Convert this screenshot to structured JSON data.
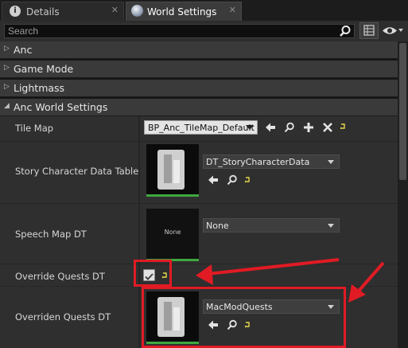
{
  "tabs": [
    {
      "label": "Details",
      "icon": "details-icon",
      "active": false
    },
    {
      "label": "World Settings",
      "icon": "world-globe-icon",
      "active": true
    }
  ],
  "search": {
    "placeholder": "Search",
    "value": ""
  },
  "categories": [
    {
      "label": "Anc",
      "expanded": false
    },
    {
      "label": "Game Mode",
      "expanded": false
    },
    {
      "label": "Lightmass",
      "expanded": false
    },
    {
      "label": "Anc World Settings",
      "expanded": true
    }
  ],
  "properties": {
    "tile_map": {
      "label": "Tile Map",
      "value": "BP_Anc_TileMap_Default"
    },
    "story_character_data_table": {
      "label": "Story Character Data Table",
      "value": "DT_StoryCharacterData"
    },
    "speech_map_dt": {
      "label": "Speech Map DT",
      "value": "None",
      "thumb_text": "None"
    },
    "override_quests_dt": {
      "label": "Override Quests DT",
      "checked": true
    },
    "overriden_quests_dt": {
      "label": "Overriden Quests DT",
      "value": "MacModQuests"
    }
  },
  "colors": {
    "annotation_red": "#e01b24",
    "asset_green": "#3fa83f",
    "reset_yellow": "#e6d84a"
  }
}
